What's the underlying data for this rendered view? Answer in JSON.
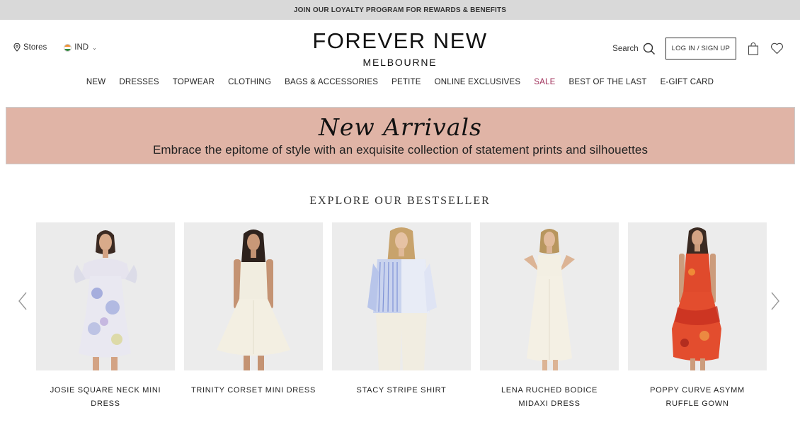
{
  "promo": {
    "text": "JOIN OUR LOYALTY PROGRAM FOR REWARDS & BENEFITS"
  },
  "header": {
    "stores_label": "Stores",
    "region_label": "IND",
    "logo_main": "FOREVER NEW",
    "logo_sub": "MELBOURNE",
    "search_label": "Search",
    "login_label": "LOG IN / SIGN UP"
  },
  "nav": {
    "items": [
      {
        "label": "NEW"
      },
      {
        "label": "DRESSES"
      },
      {
        "label": "TOPWEAR"
      },
      {
        "label": "CLOTHING"
      },
      {
        "label": "BAGS & ACCESSORIES"
      },
      {
        "label": "PETITE"
      },
      {
        "label": "ONLINE EXCLUSIVES"
      },
      {
        "label": "SALE"
      },
      {
        "label": "BEST OF THE LAST"
      },
      {
        "label": "E-GIFT CARD"
      }
    ],
    "sale_color": "#a0305a"
  },
  "banner": {
    "title": "New Arrivals",
    "subtitle": "Embrace the epitome of style with an exquisite collection of statement prints and silhouettes",
    "bg_color": "#e0b4a6"
  },
  "bestseller": {
    "title": "EXPLORE OUR BESTSELLER",
    "products": [
      {
        "name": "JOSIE SQUARE NECK MINI DRESS",
        "image": "model-in-floral-mini-dress"
      },
      {
        "name": "TRINITY CORSET MINI DRESS",
        "image": "model-in-cream-corset-dress"
      },
      {
        "name": "STACY STRIPE SHIRT",
        "image": "model-in-blue-stripe-shirt"
      },
      {
        "name": "LENA RUCHED BODICE MIDAXI DRESS",
        "image": "model-in-white-midaxi-dress"
      },
      {
        "name": "POPPY CURVE ASYMM RUFFLE GOWN",
        "image": "model-in-red-floral-gown"
      }
    ]
  },
  "icons": {
    "location": "map-pin-icon",
    "search": "search-icon",
    "bag": "shopping-bag-icon",
    "wishlist": "heart-icon",
    "prev": "chevron-left-icon",
    "next": "chevron-right-icon"
  }
}
